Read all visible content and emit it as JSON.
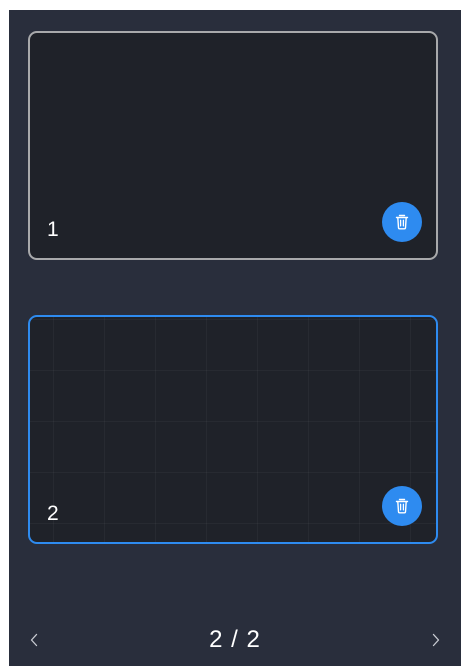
{
  "pages": [
    {
      "number": "1",
      "delete_icon": "trash-icon",
      "state": "default"
    },
    {
      "number": "2",
      "delete_icon": "trash-icon",
      "state": "selected"
    }
  ],
  "pager": {
    "indicator": "2 / 2",
    "prev_icon": "chevron-left-icon",
    "next_icon": "chevron-right-icon"
  },
  "colors": {
    "background": "#292e3c",
    "card": "#1f2229",
    "card_border": "#a8a9ab",
    "accent": "#2e8bf0",
    "text": "#ffffff"
  }
}
